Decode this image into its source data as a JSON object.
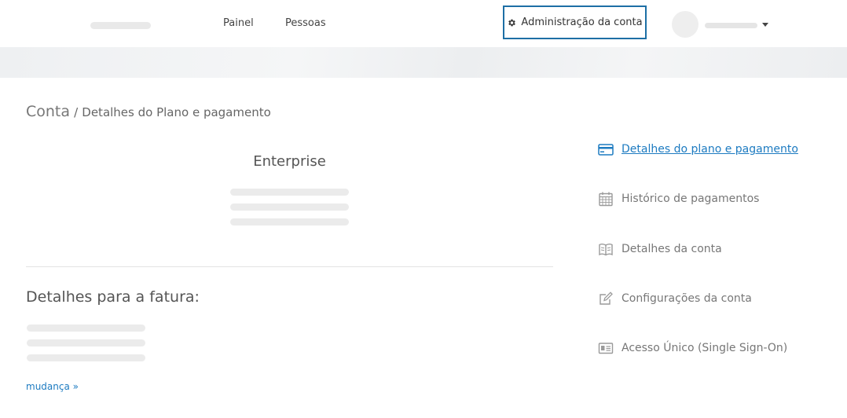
{
  "header": {
    "nav": {
      "painel": "Painel",
      "pessoas": "Pessoas"
    },
    "admin_button": {
      "label": "Administração da conta",
      "icon": "gear-icon"
    },
    "user_menu": {
      "icon": "caret-down-icon"
    }
  },
  "breadcrumb": {
    "root": "Conta",
    "separator": "/",
    "current": "Detalhes do Plano e pagamento"
  },
  "plan": {
    "name": "Enterprise"
  },
  "invoice": {
    "title": "Detalhes para a fatura:",
    "change_link": "mudança »"
  },
  "sidebar": {
    "items": [
      {
        "label": "Detalhes do plano e pagamento",
        "icon": "credit-card-icon",
        "active": true
      },
      {
        "label": "Histórico de pagamentos",
        "icon": "calendar-icon",
        "active": false
      },
      {
        "label": "Detalhes da conta",
        "icon": "book-icon",
        "active": false
      },
      {
        "label": "Configurações da conta",
        "icon": "edit-icon",
        "active": false
      },
      {
        "label": "Acesso Único (Single Sign-On)",
        "icon": "id-card-icon",
        "active": false
      }
    ]
  },
  "colors": {
    "accent": "#1d7bc1",
    "admin_border": "#1d6fa5",
    "skeleton": "#ebebeb",
    "icon_gray": "#9a9a9a"
  }
}
